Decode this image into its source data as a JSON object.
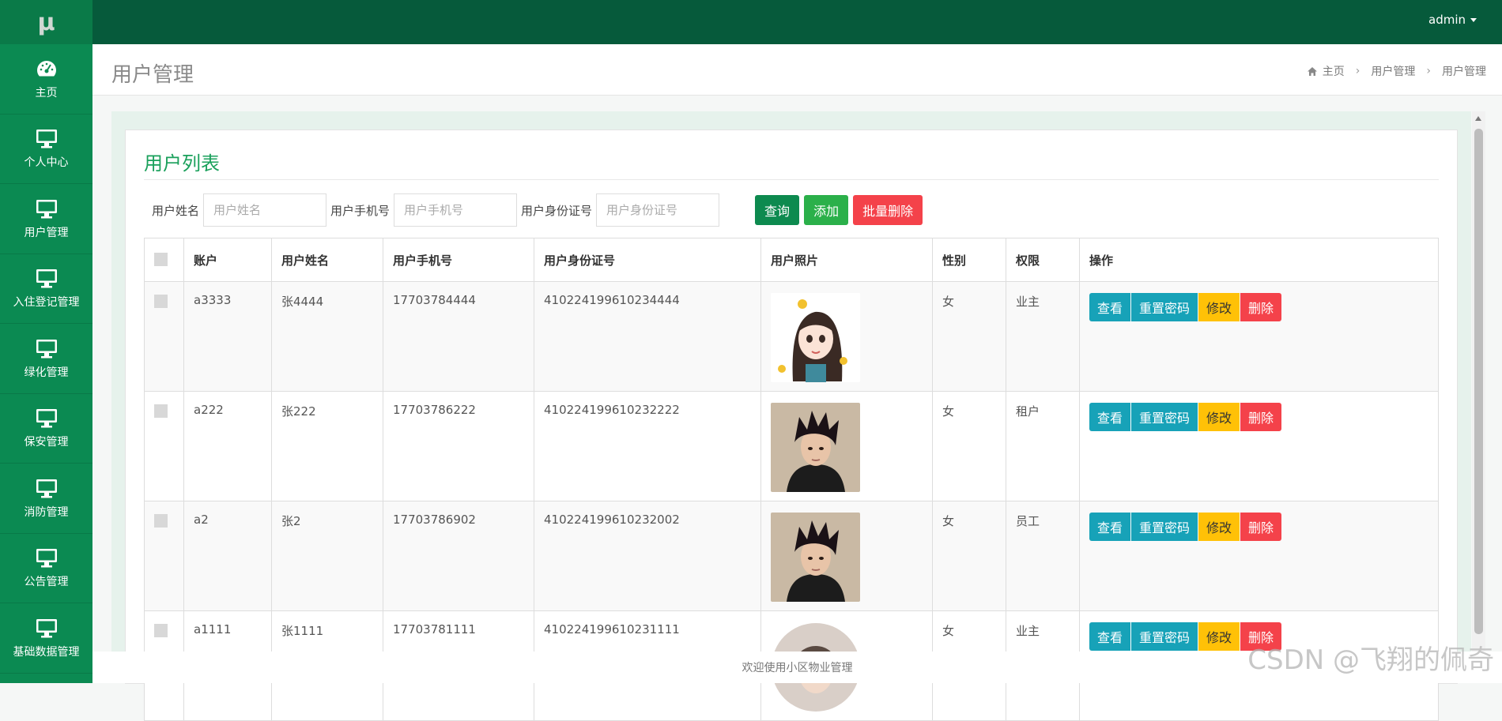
{
  "logo": "μ",
  "colors": {
    "sidebar": "#0b8a52",
    "topbar": "#065a3b",
    "accent": "#1aa05b"
  },
  "sidebar": {
    "items": [
      {
        "label": "主页",
        "icon": "dashboard-icon"
      },
      {
        "label": "个人中心",
        "icon": "monitor-icon"
      },
      {
        "label": "用户管理",
        "icon": "monitor-icon"
      },
      {
        "label": "入住登记管理",
        "icon": "monitor-icon"
      },
      {
        "label": "绿化管理",
        "icon": "monitor-icon"
      },
      {
        "label": "保安管理",
        "icon": "monitor-icon"
      },
      {
        "label": "消防管理",
        "icon": "monitor-icon"
      },
      {
        "label": "公告管理",
        "icon": "monitor-icon"
      },
      {
        "label": "基础数据管理",
        "icon": "monitor-icon"
      }
    ]
  },
  "topbar": {
    "user": "admin"
  },
  "header": {
    "title": "用户管理",
    "breadcrumb": [
      "主页",
      "用户管理",
      "用户管理"
    ]
  },
  "panel": {
    "title": "用户列表",
    "search": {
      "name_label": "用户姓名",
      "name_placeholder": "用户姓名",
      "phone_label": "用户手机号",
      "phone_placeholder": "用户手机号",
      "id_label": "用户身份证号",
      "id_placeholder": "用户身份证号",
      "query": "查询",
      "add": "添加",
      "batch_delete": "批量删除"
    },
    "table": {
      "columns": [
        "账户",
        "用户姓名",
        "用户手机号",
        "用户身份证号",
        "用户照片",
        "性别",
        "权限",
        "操作"
      ],
      "actions": {
        "view": "查看",
        "reset": "重置密码",
        "edit": "修改",
        "delete": "删除"
      },
      "rows": [
        {
          "account": "a3333",
          "name": "张4444",
          "phone": "17703784444",
          "idcard": "410224199610234444",
          "gender": "女",
          "role": "业主"
        },
        {
          "account": "a222",
          "name": "张222",
          "phone": "17703786222",
          "idcard": "410224199610232222",
          "gender": "女",
          "role": "租户"
        },
        {
          "account": "a2",
          "name": "张2",
          "phone": "17703786902",
          "idcard": "410224199610232002",
          "gender": "女",
          "role": "员工"
        },
        {
          "account": "a1111",
          "name": "张1111",
          "phone": "17703781111",
          "idcard": "410224199610231111",
          "gender": "女",
          "role": "业主"
        }
      ]
    }
  },
  "footer": "欢迎使用小区物业管理",
  "watermark": "CSDN @飞翔的佩奇"
}
